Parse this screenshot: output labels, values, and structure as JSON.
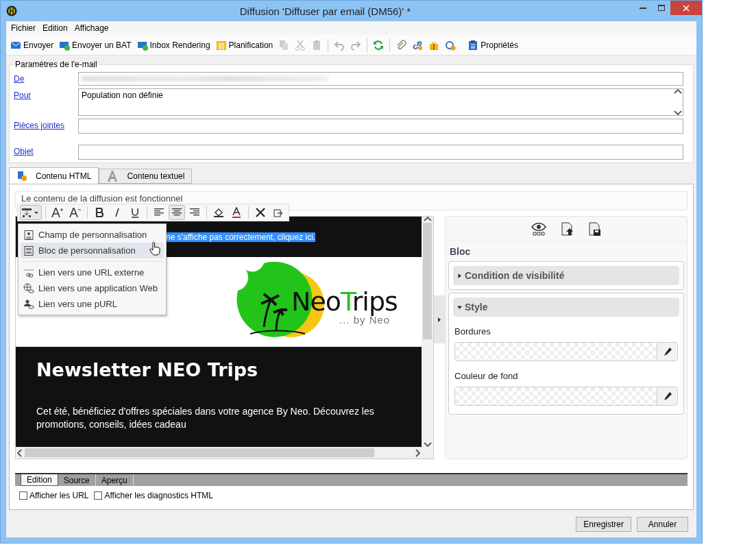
{
  "window": {
    "title": "Diffusion 'Diffuser par email (DM56)' *"
  },
  "menu": [
    "Fichier",
    "Edition",
    "Affichage"
  ],
  "toolbar": [
    {
      "kind": "button",
      "label": "Envoyer"
    },
    {
      "kind": "button",
      "label": "Envoyer un BAT"
    },
    {
      "kind": "button",
      "label": "Inbox Rendering"
    },
    {
      "kind": "button",
      "label": "Planification"
    },
    {
      "kind": "icon",
      "disabled": true
    },
    {
      "kind": "icon",
      "disabled": true
    },
    {
      "kind": "icon",
      "disabled": true
    },
    {
      "kind": "icon",
      "disabled": true
    },
    {
      "kind": "icon",
      "disabled": true
    },
    {
      "kind": "icon",
      "disabled": false
    },
    {
      "kind": "icon",
      "disabled": false
    },
    {
      "kind": "icon",
      "disabled": false
    },
    {
      "kind": "icon",
      "disabled": false
    },
    {
      "kind": "icon",
      "disabled": false
    },
    {
      "kind": "button",
      "label": "Propriétés"
    }
  ],
  "email_params": {
    "legend": "Paramètres de l'e-mail",
    "fields": [
      {
        "kind": "redacted",
        "label": "De"
      },
      {
        "kind": "textarea",
        "label": "Pour",
        "value": "Population non définie"
      },
      {
        "kind": "input",
        "label": "Pièces jointes"
      },
      {
        "kind": "input",
        "label": "Objet"
      }
    ]
  },
  "tabs": [
    {
      "label": "Contenu HTML",
      "selected": true
    },
    {
      "label": "Contenu textuel",
      "selected": false
    }
  ],
  "notice": "Le contenu de la diffusion est fonctionnel",
  "format_toolbar": {
    "insert_expanded": true,
    "alignment": [
      {
        "selected": false
      },
      {
        "selected": true
      },
      {
        "selected": false
      }
    ]
  },
  "insert_menu": [
    {
      "label": "Champ de personnalisation",
      "selected": false
    },
    {
      "label": "Bloc de personnalisation",
      "selected": true
    },
    {
      "label": "Lien vers une URL externe",
      "selected": false
    },
    {
      "label": "Lien vers une application Web",
      "selected": false
    },
    {
      "label": "Lien vers une pURL",
      "selected": false
    }
  ],
  "email": {
    "header_link": "ne s'affiche pas correctement, cliquez ici.",
    "logo_parts": [
      {
        "text": "Neo",
        "color": "#111111"
      },
      {
        "text": "T",
        "color": "#22c41a"
      },
      {
        "text": "rips",
        "color": "#111111"
      }
    ],
    "logo_tagline": "... by Neo",
    "title": "Newsletter NEO Trips",
    "body": "Cet été, bénéficiez d'offres spéciales dans votre agence By Neo. Découvrez les promotions, conseils, idées cadeau"
  },
  "side_panel": {
    "heading": "Bloc",
    "sections": [
      {
        "title": "Condition de visibilité",
        "expanded": false
      },
      {
        "title": "Style",
        "expanded": true,
        "fields": [
          {
            "label": "Bordures"
          },
          {
            "label": "Couleur de fond"
          }
        ]
      }
    ]
  },
  "bottom_tabs": [
    {
      "label": "Edition",
      "selected": true
    },
    {
      "label": "Source",
      "selected": false
    },
    {
      "label": "Aperçu",
      "selected": false
    }
  ],
  "checkboxes": [
    {
      "label": "Afficher les URL",
      "checked": false
    },
    {
      "label": "Afficher les diagnostics HTML",
      "checked": false
    }
  ],
  "buttons": [
    "Enregistrer",
    "Annuler"
  ]
}
